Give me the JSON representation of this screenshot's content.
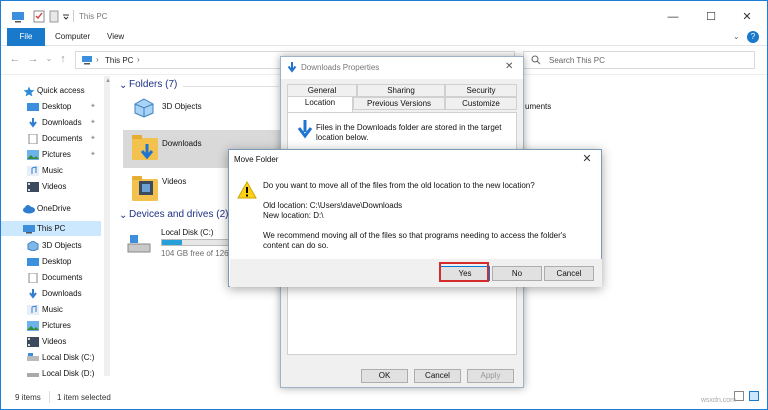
{
  "window": {
    "title": "This PC",
    "min_glyph": "—",
    "max_glyph": "☐",
    "close_glyph": "✕"
  },
  "ribbon": {
    "tabs": [
      "File",
      "Computer",
      "View"
    ],
    "expand_glyph": "⌄",
    "help_glyph": "?"
  },
  "address": {
    "path": "This PC",
    "sep": "›",
    "search_placeholder": "Search This PC"
  },
  "sidebar": {
    "items": [
      {
        "label": "Quick access"
      },
      {
        "label": "Desktop"
      },
      {
        "label": "Downloads"
      },
      {
        "label": "Documents"
      },
      {
        "label": "Pictures"
      },
      {
        "label": "Music"
      },
      {
        "label": "Videos"
      },
      {
        "label": "OneDrive"
      },
      {
        "label": "This PC"
      },
      {
        "label": "3D Objects"
      },
      {
        "label": "Desktop"
      },
      {
        "label": "Documents"
      },
      {
        "label": "Downloads"
      },
      {
        "label": "Music"
      },
      {
        "label": "Pictures"
      },
      {
        "label": "Videos"
      },
      {
        "label": "Local Disk (C:)"
      },
      {
        "label": "Local Disk (D:)"
      }
    ]
  },
  "content": {
    "folders_header": "Folders (7)",
    "folders": [
      "3D Objects",
      "Downloads",
      "Videos"
    ],
    "drives_header": "Devices and drives (2)",
    "drive_name": "Local Disk (C:)",
    "drive_free": "104 GB free of 126 G",
    "drive_used_fraction": 0.17,
    "right_fragment": "uments"
  },
  "status": {
    "items": "9 items",
    "selected": "1 item selected"
  },
  "props": {
    "title": "Downloads Properties",
    "tabs_row1": [
      "General",
      "Sharing",
      "Security"
    ],
    "tabs_row2": [
      "Location",
      "Previous Versions",
      "Customize"
    ],
    "info": "Files in the Downloads folder are stored in the target location below.",
    "buttons": {
      "ok": "OK",
      "cancel": "Cancel",
      "apply": "Apply"
    }
  },
  "move_dialog": {
    "title": "Move Folder",
    "question": "Do you want to move all of the files from the old location to the new location?",
    "old_location": "Old location: C:\\Users\\dave\\Downloads",
    "new_location": "New location: D:\\",
    "recommend": "We recommend moving all of the files so that programs needing to access the folder's content can do so.",
    "buttons": {
      "yes": "Yes",
      "no": "No",
      "cancel": "Cancel"
    }
  },
  "watermark": "wsxdn.com",
  "colors": {
    "accent": "#1979ca",
    "highlight": "#d52b2b",
    "folder": "#f3c24e"
  }
}
